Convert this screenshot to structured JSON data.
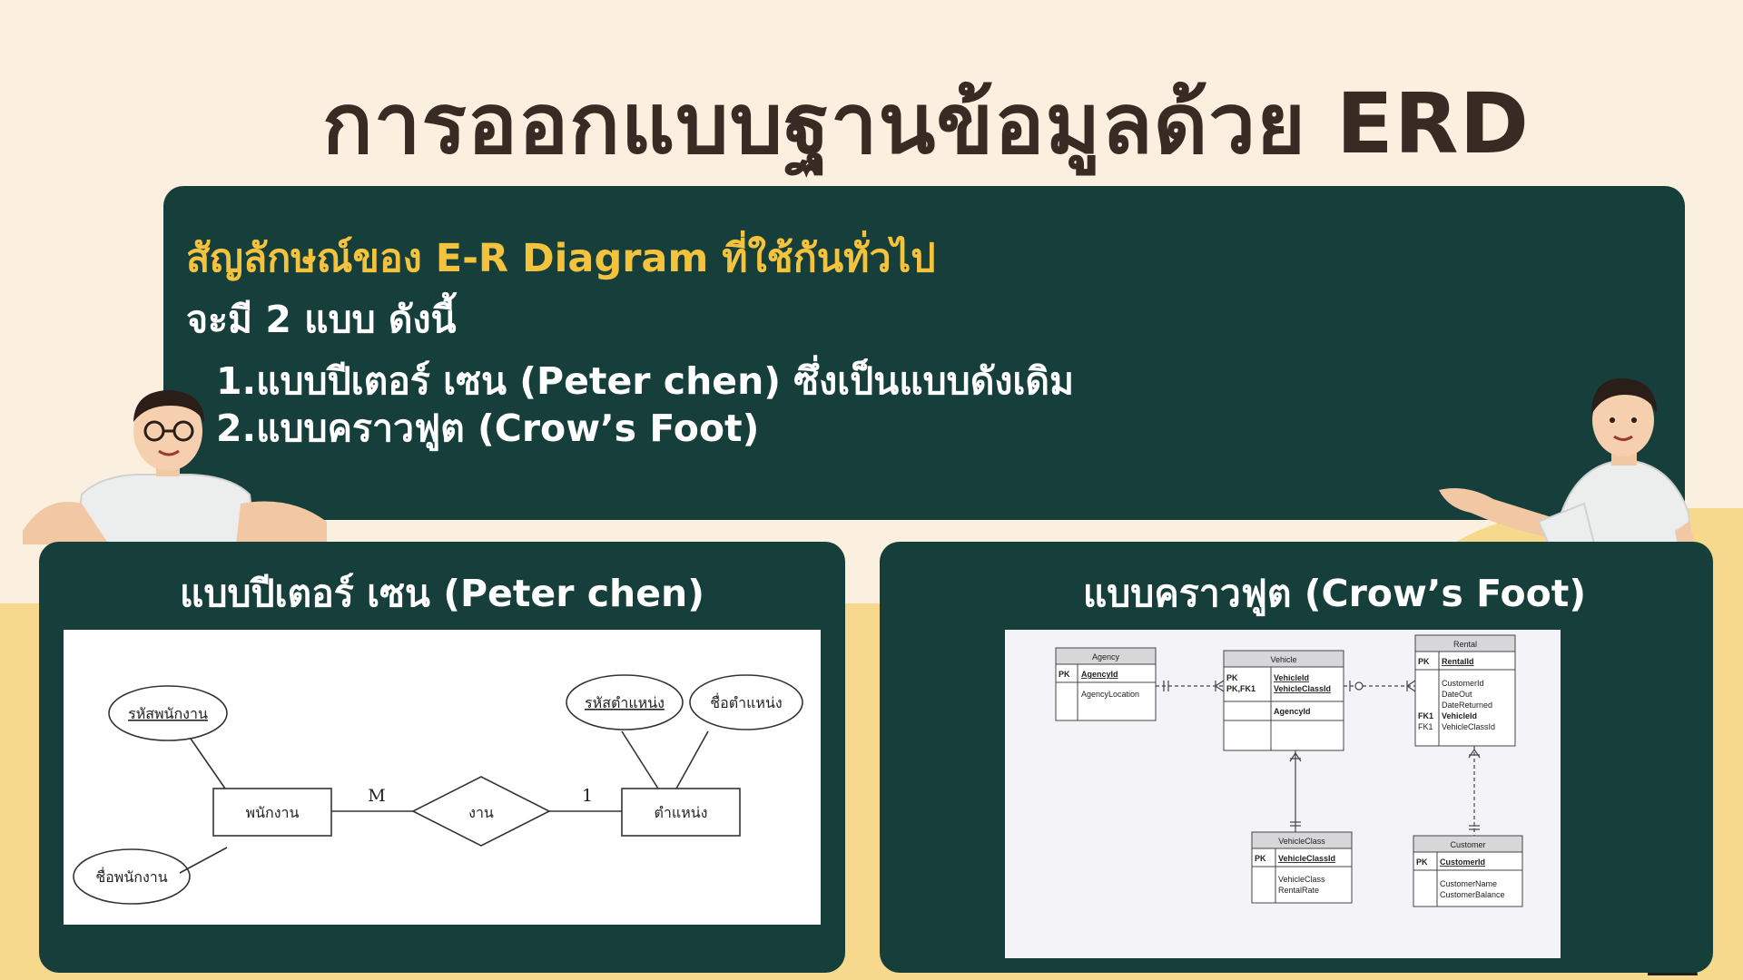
{
  "title": "การออกแบบฐานข้อมูลด้วย ERD",
  "intro": {
    "subtitle": "สัญลักษณ์ของ E-R Diagram ที่ใช้กันทั่วไป",
    "line": "จะมี 2 แบบ ดังนี้",
    "items": [
      "1.แบบปีเตอร์ เซน (Peter chen) ซึ่งเป็นแบบดังเดิม",
      "2.แบบคราวฟูต (Crow’s Foot)"
    ]
  },
  "chen": {
    "title": "แบบปีเตอร์ เซน (Peter chen)",
    "entity_left": "พนักงาน",
    "entity_right": "ตำแหน่ง",
    "relationship": "งาน",
    "card_left": "M",
    "card_right": "1",
    "attr_emp_id": "รหัสพนักงาน",
    "attr_emp_name": "ชื่อพนักงาน",
    "attr_pos_id": "รหัสตำแหน่ง",
    "attr_pos_name": "ชื่อตำแหน่ง"
  },
  "crow": {
    "title": "แบบคราวฟูต (Crow’s Foot)",
    "agency": {
      "name": "Agency",
      "pk": "PK",
      "key": "AgencyId",
      "attrs": [
        "AgencyLocation"
      ]
    },
    "vehicle": {
      "name": "Vehicle",
      "pk1": "PK",
      "pk2": "PK,FK1",
      "key1": "VehicleId",
      "key2": "VehicleClassId",
      "attrs": [
        "AgencyId"
      ]
    },
    "rental": {
      "name": "Rental",
      "pk": "PK",
      "key": "RentalId",
      "attrs": [
        "CustomerId",
        "DateOut",
        "DateReturned"
      ],
      "fk1": "FK1",
      "fk_key1": "VehicleId",
      "fk2": "FK1",
      "fk_key2": "VehicleClassId"
    },
    "vehicle_class": {
      "name": "VehicleClass",
      "pk": "PK",
      "key": "VehicleClassId",
      "attrs": [
        "VehicleClass",
        "RentalRate"
      ]
    },
    "customer": {
      "name": "Customer",
      "pk": "PK",
      "key": "CustomerId",
      "attrs": [
        "CustomerName",
        "CustomerBalance"
      ]
    }
  },
  "colors": {
    "panel": "#163e3a",
    "accent": "#f4c33e",
    "background": "#fbf0df",
    "band": "#f6d98c"
  }
}
